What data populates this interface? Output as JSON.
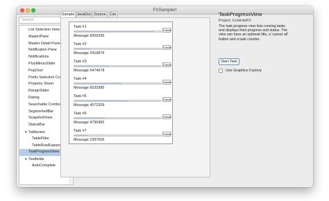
{
  "window": {
    "title": "FXSampler!"
  },
  "search": {
    "placeholder": "Search"
  },
  "sidebar": {
    "items": [
      {
        "label": "List Selection View",
        "kind": "leaf"
      },
      {
        "label": "MasterPane",
        "kind": "leaf"
      },
      {
        "label": "Master Detail Pane",
        "kind": "leaf"
      },
      {
        "label": "Notification Pane",
        "kind": "leaf"
      },
      {
        "label": "Notifications",
        "kind": "leaf"
      },
      {
        "label": "PlusMinusSlider",
        "kind": "leaf"
      },
      {
        "label": "PopOver",
        "kind": "leaf"
      },
      {
        "label": "Prefix Selection ComboBox",
        "kind": "leaf"
      },
      {
        "label": "Property Sheet",
        "kind": "leaf"
      },
      {
        "label": "RangeSlider",
        "kind": "leaf"
      },
      {
        "label": "Rating",
        "kind": "leaf"
      },
      {
        "label": "Searchable ComboBox",
        "kind": "leaf"
      },
      {
        "label": "SegmentedBar",
        "kind": "leaf"
      },
      {
        "label": "SnapshotView",
        "kind": "leaf"
      },
      {
        "label": "StatusBar",
        "kind": "leaf"
      },
      {
        "label": "Tableview",
        "kind": "folder"
      },
      {
        "label": "TableFilter",
        "kind": "child"
      },
      {
        "label": "TableRowExpanderColumn",
        "kind": "child"
      },
      {
        "label": "TaskProgressView",
        "kind": "leaf",
        "selected": true
      },
      {
        "label": "Textfields",
        "kind": "folder"
      },
      {
        "label": "AutoComplete",
        "kind": "child"
      }
    ]
  },
  "tabs": [
    {
      "label": "Sample",
      "active": true
    },
    {
      "label": "JavaDoc"
    },
    {
      "label": "Source"
    },
    {
      "label": "Css"
    }
  ],
  "tasks": [
    {
      "title": "Task #1",
      "message": "Message 8309335",
      "progress": 0.92
    },
    {
      "title": "Task #2",
      "message": "Message 2419876",
      "progress": 0.18
    },
    {
      "title": "Task #3",
      "message": "Message 5474678",
      "progress": 0.4
    },
    {
      "title": "Task #4",
      "message": "Message 5032985",
      "progress": 0.55
    },
    {
      "title": "Task #5",
      "message": "Message 4572209",
      "progress": 0.62
    },
    {
      "title": "Task #6",
      "message": "Message 4795982",
      "progress": 0.35
    },
    {
      "title": "Task #7",
      "message": "Message 2397605",
      "progress": 0.15
    }
  ],
  "task_cancel_label": "Cancel",
  "info": {
    "title": "TaskProgressView",
    "project": "Project: ControlsFX",
    "description": "The task progress view lists running tasks and displays their progress and status. The view can have an optional title, a 'cancel all' button and a task counter.",
    "start_button": "Start Task",
    "graphics_factory_label": "Use Graphics Factory"
  },
  "colors": {
    "selection": "#b5cde8",
    "progress_fill": "#a5c6e6",
    "focus_border": "#5a96d6"
  }
}
